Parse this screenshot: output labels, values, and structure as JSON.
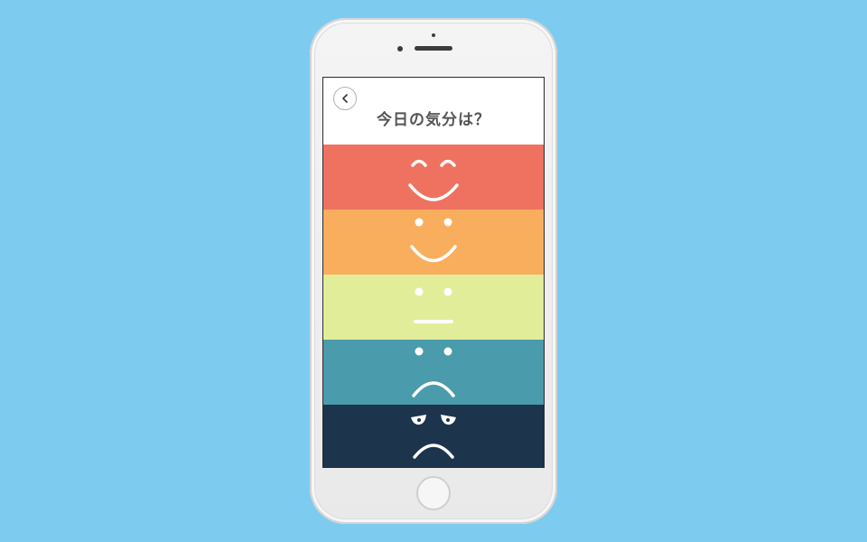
{
  "header": {
    "title": "今日の気分は？",
    "back_icon": "chevron-left-icon"
  },
  "moods": [
    {
      "name": "very-happy",
      "color": "#ef7260",
      "icon": "very-happy-face-icon"
    },
    {
      "name": "happy",
      "color": "#f8ae5d",
      "icon": "happy-face-icon"
    },
    {
      "name": "neutral",
      "color": "#e2ed9a",
      "icon": "neutral-face-icon"
    },
    {
      "name": "sad",
      "color": "#4a9bab",
      "icon": "sad-face-icon"
    },
    {
      "name": "very-sad",
      "color": "#1c344c",
      "icon": "very-sad-face-icon"
    }
  ],
  "background_color": "#7ecbf0"
}
